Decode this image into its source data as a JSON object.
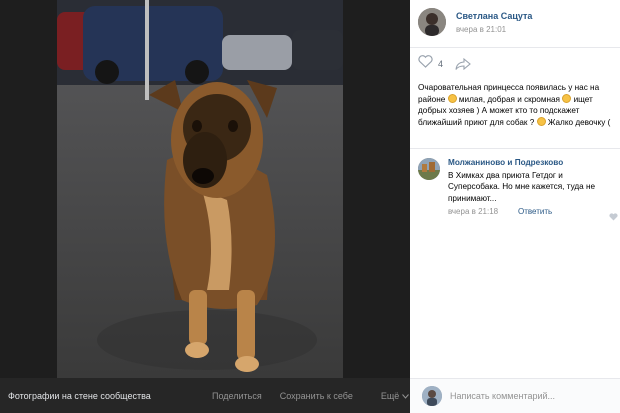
{
  "viewer": {
    "album_title": "Фотографии на стене сообщества",
    "actions": {
      "share": "Поделиться",
      "save": "Сохранить к себе",
      "more": "Ещё"
    }
  },
  "post": {
    "author": "Светлана Сацута",
    "time": "вчера в 21:01",
    "likes": "4",
    "text_1": "Очаровательная принцесса появилась у нас на районе",
    "text_2": "милая, добрая и скромная",
    "text_3": "ищет добрых хозяев ) А может кто то подскажет ближайший приют для собак ?",
    "text_4": "Жалко девочку ("
  },
  "comment": {
    "author": "Молжаниново и Подрезково",
    "text": "В Химках два приюта Гетдог и Суперсобака. Но мне кажется, туда не принимают...",
    "time": "вчера в 21:18",
    "reply": "Ответить"
  },
  "composer": {
    "placeholder": "Написать комментарий..."
  },
  "colors": {
    "link": "#2a5885",
    "muted": "#939393",
    "viewer_bg": "#1e1e1e"
  },
  "icons": {
    "like": "heart-icon",
    "share": "share-arrow-icon",
    "more": "chevron-down-icon"
  }
}
